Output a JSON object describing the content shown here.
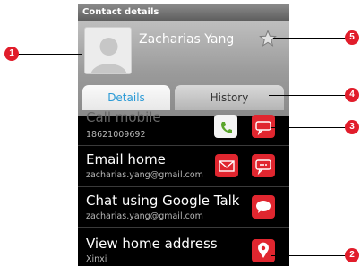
{
  "window": {
    "title": "Contact details"
  },
  "contact": {
    "name": "Zacharias Yang"
  },
  "tabs": {
    "details": "Details",
    "history": "History"
  },
  "rows": [
    {
      "title": "Call mobile",
      "subtitle": "18621009692"
    },
    {
      "title": "Email home",
      "subtitle": "zacharias.yang@gmail.com"
    },
    {
      "title": "Chat using Google Talk",
      "subtitle": "zacharias.yang@gmail.com"
    },
    {
      "title": "View home address",
      "subtitle": "Xinxi"
    }
  ],
  "callouts": [
    "1",
    "2",
    "3",
    "4",
    "5"
  ],
  "icons": [
    "avatar-icon",
    "star-icon",
    "call-icon",
    "sms-icon",
    "email-icon",
    "chat-icon",
    "map-pin-icon"
  ],
  "colors": {
    "accent": "#2a9ad6",
    "action_red": "#e0262f",
    "call_green": "#5aa52c",
    "callout_red": "#e11d2b"
  }
}
